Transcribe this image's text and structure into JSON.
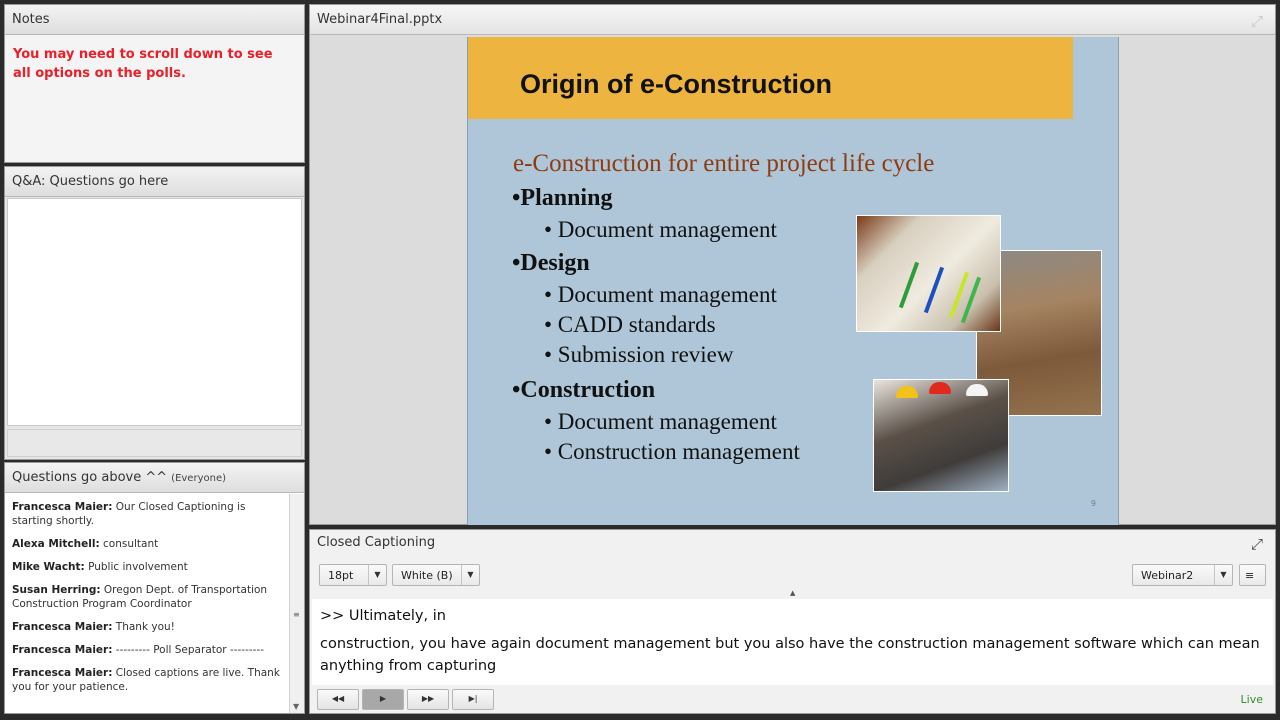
{
  "notes": {
    "title": "Notes",
    "text": "You may need to scroll down to see all options on the polls."
  },
  "qa": {
    "title": "Q&A: Questions go here"
  },
  "chat": {
    "title": "Questions go above ^^",
    "scope": "(Everyone)",
    "messages": [
      {
        "who": "Francesca Maier:",
        "text": "Our Closed Captioning is starting shortly."
      },
      {
        "who": "Alexa Mitchell:",
        "text": "consultant"
      },
      {
        "who": "Mike Wacht:",
        "text": "Public involvement"
      },
      {
        "who": "Susan Herring:",
        "text": "Oregon Dept. of Transportation Construction Program Coordinator"
      },
      {
        "who": "Francesca Maier:",
        "text": "Thank you!"
      },
      {
        "who": "Francesca Maier:",
        "text": "--------- Poll Separator ---------"
      },
      {
        "who": "Francesca Maier:",
        "text": "Closed captions are live. Thank you for your patience."
      }
    ]
  },
  "share": {
    "title": "Webinar4Final.pptx",
    "slide": {
      "title": "Origin of e-Construction",
      "subheading": "e-Construction for entire project life cycle",
      "sections": [
        {
          "heading": "•Planning",
          "items": [
            "• Document management"
          ]
        },
        {
          "heading": "•Design",
          "items": [
            "• Document management",
            "• CADD standards",
            "• Submission review"
          ]
        },
        {
          "heading": "•Construction",
          "items": [
            "• Document management",
            "• Construction management"
          ]
        }
      ],
      "page_number": "9"
    }
  },
  "captions": {
    "title": "Closed Captioning",
    "font_size": "18pt",
    "color": "White (B)",
    "stream": "Webinar2",
    "line1": ">> Ultimately, in",
    "line2": "construction, you have again document management but you also have the construction management software which can mean anything from capturing",
    "status": "Live"
  },
  "colors": {
    "notes_text": "#e8202a",
    "slide_title_band": "#edb440",
    "slide_background": "#aec6d8",
    "subheading": "#8e3b10",
    "live": "#2e8b2e"
  }
}
